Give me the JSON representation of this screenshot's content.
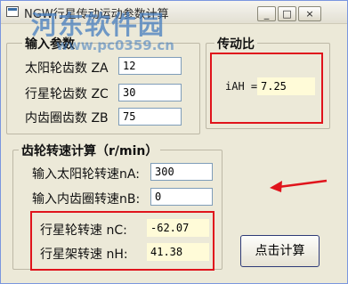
{
  "window": {
    "title": "NGW行星传动运动参数计算",
    "minimize_label": "_",
    "maximize_label": "□",
    "close_label": "×"
  },
  "watermark": {
    "text": "河东软件园",
    "url": "www.pc0359.cn"
  },
  "input_group": {
    "title": "输入参数",
    "fields": [
      {
        "label": "太阳轮齿数 ZA",
        "value": "12"
      },
      {
        "label": "行星轮齿数 ZC",
        "value": "30"
      },
      {
        "label": "内齿圈齿数 ZB",
        "value": "75"
      }
    ]
  },
  "ratio_group": {
    "title": "传动比",
    "label": "iAH =",
    "value": "7.25"
  },
  "speed_group": {
    "title": "齿轮转速计算（r/min）",
    "inputs": [
      {
        "label": "输入太阳轮转速nA:",
        "value": "300"
      },
      {
        "label": "输入内齿圈转速nB:",
        "value": "0"
      }
    ],
    "outputs": [
      {
        "label": "行星轮转速 nC:",
        "value": "-62.07"
      },
      {
        "label": "行星架转速 nH:",
        "value": "41.38"
      }
    ]
  },
  "calc_button": {
    "label": "点击计算"
  },
  "colors": {
    "annotation_red": "#e0141c",
    "readonly_bg": "#fffbd8",
    "window_bg": "#ece9d8"
  }
}
